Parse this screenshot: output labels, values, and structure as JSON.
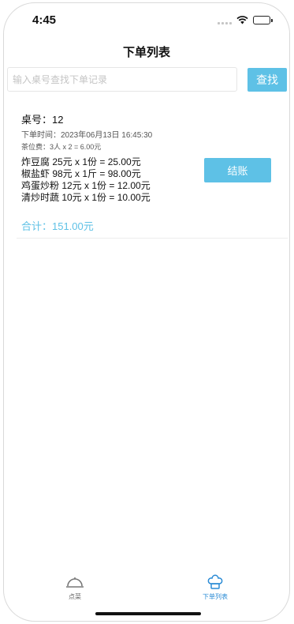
{
  "status_bar": {
    "time": "4:45"
  },
  "nav": {
    "title": "下单列表"
  },
  "search": {
    "placeholder": "输入桌号查找下单记录",
    "value": "",
    "button_label": "查找"
  },
  "order": {
    "table_number": "桌号：12",
    "order_time": "下单时间：2023年06月13日 16:45:30",
    "tea_fee": "茶位费：3人 x 2 = 6.00元",
    "items": [
      {
        "text": "炸豆腐  25元 x 1份 = 25.00元"
      },
      {
        "text": "椒盐虾  98元 x 1斤 = 98.00元"
      },
      {
        "text": "鸡蛋炒粉  12元 x 1份 = 12.00元"
      },
      {
        "text": "清炒时蔬  10元 x 1份 = 10.00元"
      }
    ],
    "checkout_label": "结账",
    "total": "合计：151.00元"
  },
  "tab_bar": {
    "tabs": [
      {
        "label": "点菜",
        "icon": "dome-icon",
        "active": false
      },
      {
        "label": "下单列表",
        "icon": "chef-hat-icon",
        "active": true
      }
    ]
  },
  "colors": {
    "accent": "#5ec1e6",
    "active_tab": "#2a8bd5"
  }
}
